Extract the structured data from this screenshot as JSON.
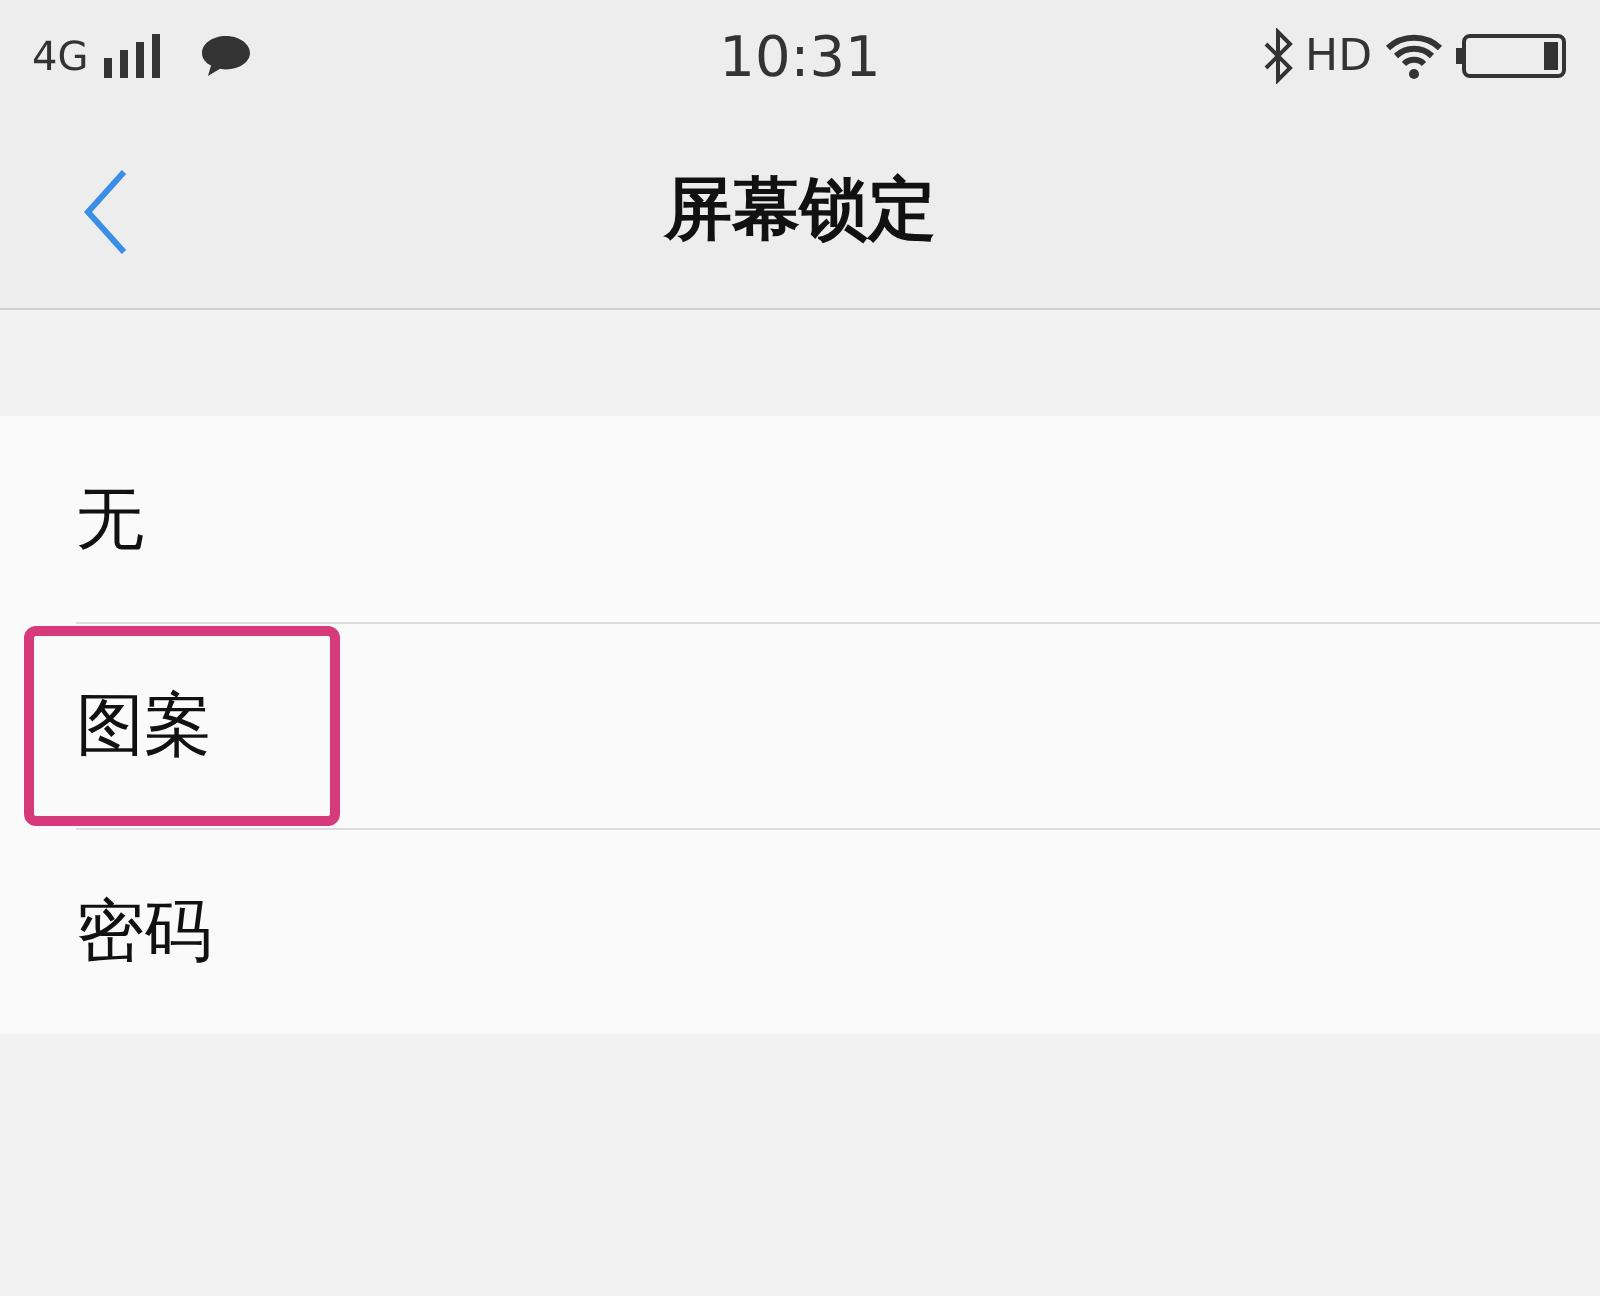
{
  "status_bar": {
    "network": "4G",
    "time": "10:31",
    "hd": "HD"
  },
  "nav": {
    "title": "屏幕锁定"
  },
  "options": [
    {
      "label": "无",
      "highlighted": false
    },
    {
      "label": "图案",
      "highlighted": true
    },
    {
      "label": "密码",
      "highlighted": false
    }
  ]
}
